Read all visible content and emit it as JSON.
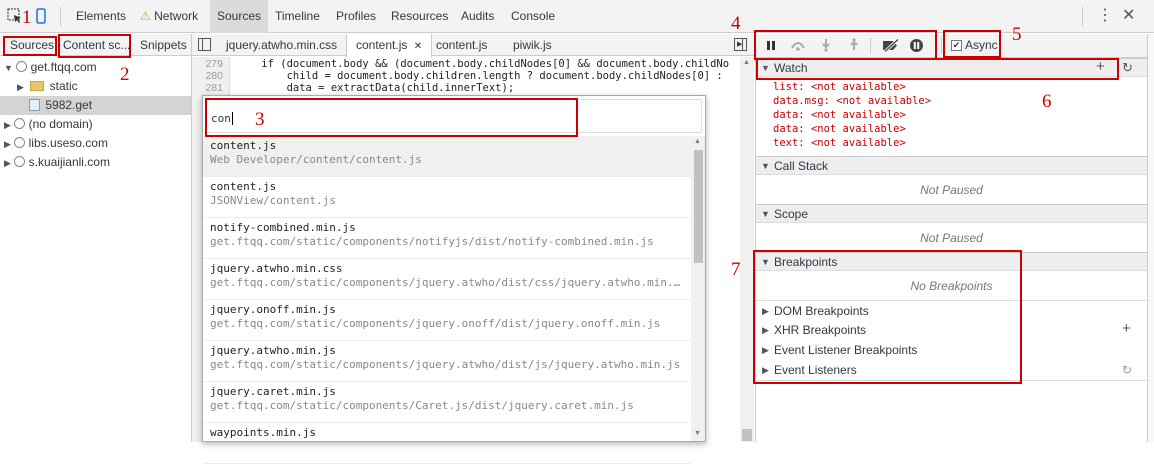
{
  "toolbar": {
    "tabs": [
      "Elements",
      "Network",
      "Sources",
      "Timeline",
      "Profiles",
      "Resources",
      "Audits",
      "Console"
    ],
    "active_tab": "Sources",
    "network_warning_icon": "warning-icon",
    "more_icon": "more-vert-icon",
    "close_icon": "close-icon"
  },
  "navigator": {
    "tabs": [
      "Sources",
      "Content sc...",
      "Snippets"
    ],
    "tree": [
      {
        "label": "get.ftqq.com",
        "icon": "cloud-icon",
        "expanded": true,
        "level": 0
      },
      {
        "label": "static",
        "icon": "folder-icon",
        "expanded": false,
        "level": 1
      },
      {
        "label": "5982.get",
        "icon": "file-icon",
        "level": 2,
        "selected": true
      },
      {
        "label": "(no domain)",
        "icon": "cloud-icon",
        "expanded": false,
        "level": 0
      },
      {
        "label": "libs.useso.com",
        "icon": "cloud-icon",
        "expanded": false,
        "level": 0
      },
      {
        "label": "s.kuaijianli.com",
        "icon": "cloud-icon",
        "expanded": false,
        "level": 0
      }
    ]
  },
  "editor": {
    "tabs": [
      "jquery.atwho.min.css",
      "content.js",
      "content.js",
      "piwik.js"
    ],
    "active_tab_index": 1,
    "lines": [
      {
        "num": "279",
        "text": "    if (document.body && (document.body.childNodes[0] && document.body.childNo"
      },
      {
        "num": "280",
        "text": "        child = document.body.children.length ? document.body.childNodes[0] :"
      },
      {
        "num": "281",
        "text": "        data = extractData(child.innerText);"
      }
    ]
  },
  "quick_open": {
    "query": "con",
    "items": [
      {
        "title": "content.js",
        "path": "Web Developer/content/content.js"
      },
      {
        "title": "content.js",
        "path": "JSONView/content.js"
      },
      {
        "title": "notify-combined.min.js",
        "path": "get.ftqq.com/static/components/notifyjs/dist/notify-combined.min.js"
      },
      {
        "title": "jquery.atwho.min.css",
        "path": "get.ftqq.com/static/components/jquery.atwho/dist/css/jquery.atwho.min..."
      },
      {
        "title": "jquery.onoff.min.js",
        "path": "get.ftqq.com/static/components/jquery.onoff/dist/jquery.onoff.min.js"
      },
      {
        "title": "jquery.atwho.min.js",
        "path": "get.ftqq.com/static/components/jquery.atwho/dist/js/jquery.atwho.min.js"
      },
      {
        "title": "jquery.caret.min.js",
        "path": "get.ftqq.com/static/components/Caret.js/dist/jquery.caret.min.js"
      },
      {
        "title": "waypoints.min.js",
        "path": ""
      }
    ]
  },
  "debugger": {
    "async_label": "Async",
    "async_checked": true,
    "sections": {
      "watch": "Watch",
      "call_stack": "Call Stack",
      "scope": "Scope",
      "breakpoints": "Breakpoints",
      "dom_breakpoints": "DOM Breakpoints",
      "xhr_breakpoints": "XHR Breakpoints",
      "event_listener_breakpoints": "Event Listener Breakpoints",
      "event_listeners": "Event Listeners"
    },
    "watch_items": [
      {
        "name": "list",
        "value": "<not available>"
      },
      {
        "name": "data.msg",
        "value": "<not available>"
      },
      {
        "name": "data",
        "value": "<not available>"
      },
      {
        "name": "data",
        "value": "<not available>"
      },
      {
        "name": "text",
        "value": "<not available>"
      }
    ],
    "not_paused": "Not Paused",
    "not_paused_scope": "Not Paused",
    "no_breakpoints": "No Breakpoints"
  },
  "annotations": {
    "numbers": [
      "1",
      "2",
      "3",
      "4",
      "5",
      "6",
      "7"
    ],
    "color": "#cc0000"
  }
}
